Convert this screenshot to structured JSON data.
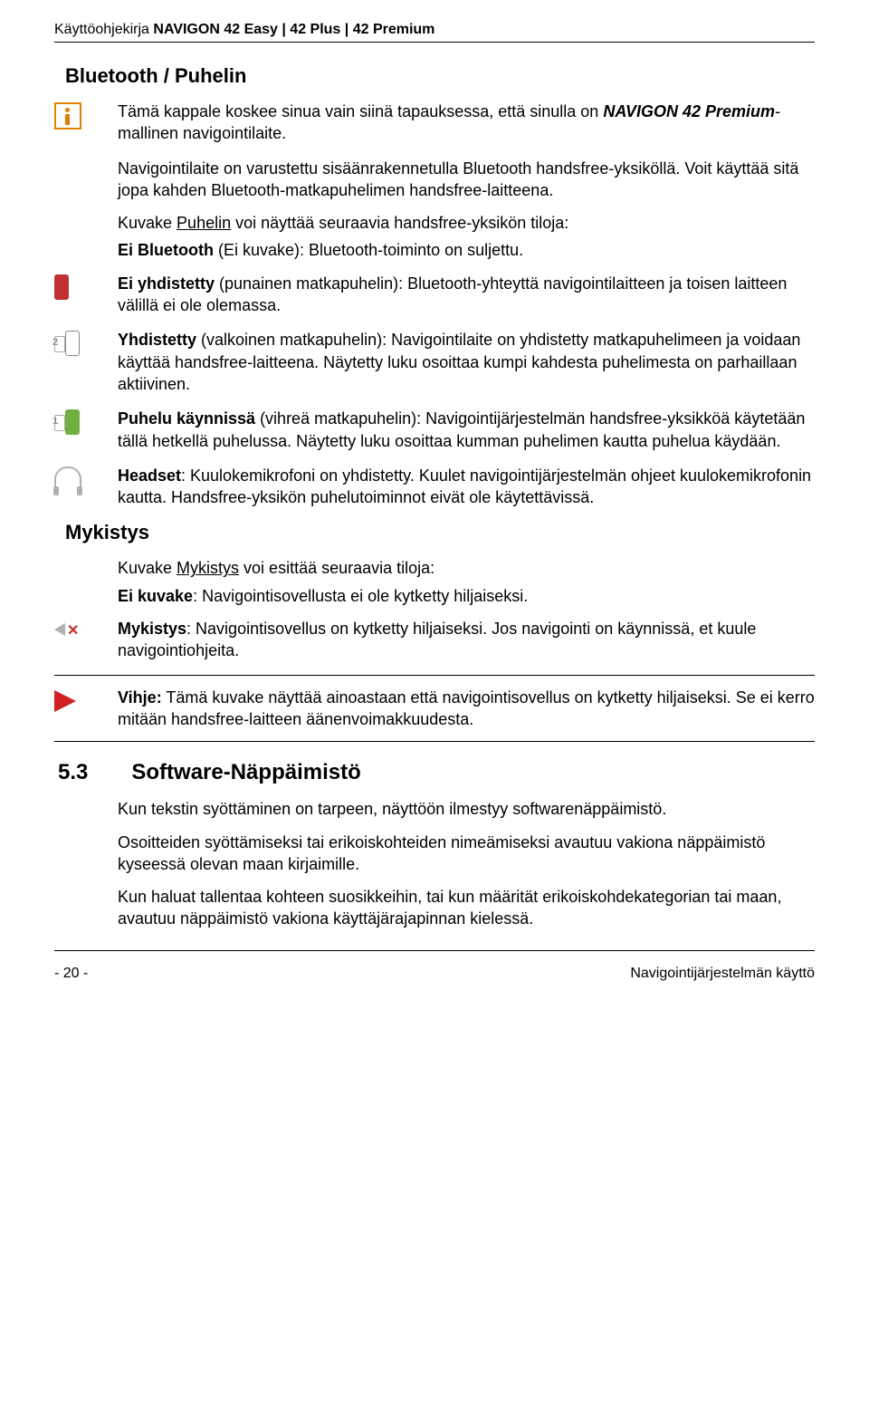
{
  "header": {
    "title_plain": "Käyttöohjekirja ",
    "title_products": "NAVIGON 42 Easy | 42 Plus | 42 Premium"
  },
  "sec_bluetooth": {
    "heading": "Bluetooth / Puhelin",
    "info": {
      "p1a": "Tämä kappale koskee sinua vain siinä tapauksessa, että sinulla on ",
      "p1b": "NAVIGON 42 Premium",
      "p1c": "-mallinen navigointilaite."
    },
    "intro": {
      "p1": "Navigointilaite on varustettu sisäänrakennetulla Bluetooth handsfree-yksiköllä. Voit käyttää sitä jopa kahden Bluetooth-matkapuhelimen handsfree-laitteena.",
      "p2a": "Kuvake ",
      "p2b": "Puhelin",
      "p2c": " voi näyttää seuraavia handsfree-yksikön tiloja:",
      "p3a": "Ei Bluetooth",
      "p3b": " (Ei kuvake): Bluetooth-toiminto on suljettu."
    },
    "not_connected": {
      "a": "Ei yhdistetty",
      "b": " (punainen matkapuhelin): Bluetooth-yhteyttä navigointilaitteen ja toisen laitteen välillä ei ole olemassa."
    },
    "connected": {
      "a": "Yhdistetty",
      "b": " (valkoinen matkapuhelin): Navigointilaite on yhdistetty matkapuhelimeen ja voidaan käyttää handsfree-laitteena. Näytetty luku osoittaa kumpi kahdesta puhelimesta on parhaillaan aktiivinen."
    },
    "call": {
      "a": "Puhelu käynnissä",
      "b": " (vihreä matkapuhelin): Navigointijärjestelmän handsfree-yksikköä käytetään tällä hetkellä puhelussa. Näytetty luku osoittaa kumman puhelimen kautta puhelua käydään."
    },
    "headset": {
      "a": "Headset",
      "b": ": Kuulokemikrofoni on yhdistetty. Kuulet navigointijärjestelmän ohjeet kuulokemikrofonin kautta. Handsfree-yksikön puhelutoiminnot eivät ole käytettävissä."
    }
  },
  "sec_mute": {
    "heading": "Mykistys",
    "p1a": "Kuvake ",
    "p1b": "Mykistys",
    "p1c": " voi esittää seuraavia tiloja:",
    "p2a": "Ei kuvake",
    "p2b": ": Navigointisovellusta ei ole kytketty hiljaiseksi.",
    "mute": {
      "a": "Mykistys",
      "b": ": Navigointisovellus on kytketty hiljaiseksi. Jos navigointi on käynnissä, et kuule navigointiohjeita."
    },
    "tip": {
      "a": "Vihje:",
      "b": " Tämä kuvake näyttää ainoastaan että navigointisovellus on kytketty hiljaiseksi. Se ei kerro mitään handsfree-laitteen äänenvoimakkuudesta."
    }
  },
  "sec_soft": {
    "num": "5.3",
    "title": "Software-Näppäimistö",
    "p1": "Kun tekstin syöttäminen on tarpeen, näyttöön ilmestyy softwarenäppäimistö.",
    "p2": "Osoitteiden syöttämiseksi tai erikoiskohteiden nimeämiseksi avautuu vakiona näppäimistö kyseessä olevan maan kirjaimille.",
    "p3": "Kun haluat tallentaa kohteen suosikkeihin, tai kun määrität erikoiskohdekategorian tai maan, avautuu näppäimistö vakiona käyttäjärajapinnan kielessä."
  },
  "footer": {
    "page": "- 20 -",
    "section": "Navigointijärjestelmän käyttö"
  }
}
